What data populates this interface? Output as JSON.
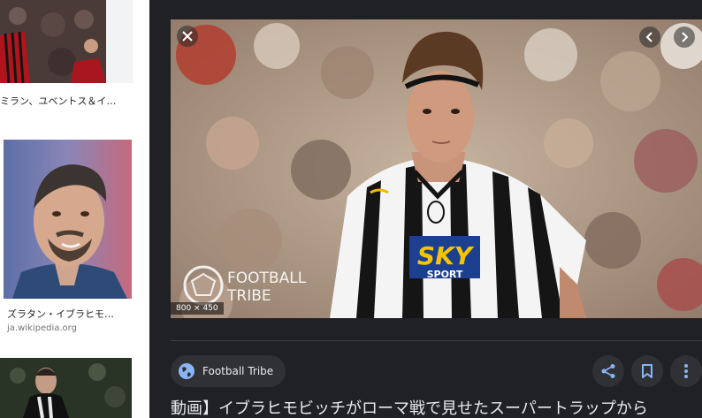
{
  "results": [
    {
      "title": "ミラン、ユベントス＆イ…",
      "source": ""
    },
    {
      "title": "ズラタン・イブラヒモ…",
      "source": "ja.wikipedia.org"
    }
  ],
  "preview": {
    "close_icon": "close-icon",
    "prev_icon": "chevron-left-icon",
    "next_icon": "chevron-right-icon",
    "dimensions": "800 × 450",
    "watermark_lines": [
      "FOOTBALL",
      "TRIBE"
    ],
    "jersey_sponsor": "SKY",
    "jersey_sponsor_sub": "SPORT",
    "source_name": "Football Tribe",
    "caption": "動画】イブラヒモビッチがローマ戦で見せたスーパートラップから"
  },
  "colors": {
    "panel_bg": "#202124",
    "chip_bg": "#303134",
    "action_icon": "#8ab4f8",
    "text": "#e8eaed"
  }
}
